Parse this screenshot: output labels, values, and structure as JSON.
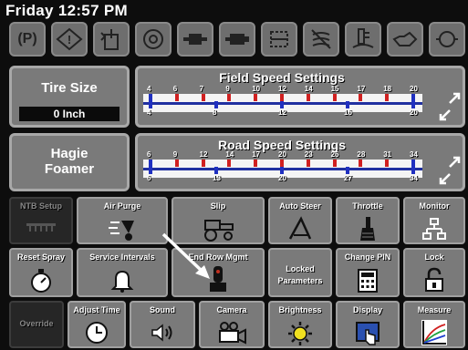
{
  "header": {
    "day_time": "Friday 12:57 PM"
  },
  "warnings": [
    {
      "name": "parking-brake-icon",
      "text": "(P)"
    },
    {
      "name": "engine-warning-icon",
      "text": "!"
    },
    {
      "name": "hydraulic-oil-icon"
    },
    {
      "name": "wheel-icon"
    },
    {
      "name": "transmission-icon"
    },
    {
      "name": "engine-icon"
    },
    {
      "name": "cooling-icon"
    },
    {
      "name": "no-coolant-icon"
    },
    {
      "name": "fuel-temp-icon"
    },
    {
      "name": "oil-icon"
    },
    {
      "name": "oil-pressure-icon"
    }
  ],
  "tire": {
    "title": "Tire Size",
    "value": "0 Inch"
  },
  "field": {
    "title": "Field Speed Settings",
    "top": [
      "4",
      "6",
      "7",
      "9",
      "10",
      "12",
      "14",
      "15",
      "17",
      "18",
      "20"
    ],
    "bottom": [
      "4",
      "8",
      "12",
      "16",
      "20"
    ]
  },
  "hagie": {
    "line1": "Hagie",
    "line2": "Foamer"
  },
  "road": {
    "title": "Road Speed Settings",
    "top": [
      "6",
      "9",
      "12",
      "14",
      "17",
      "20",
      "23",
      "26",
      "28",
      "31",
      "34"
    ],
    "bottom": [
      "6",
      "13",
      "20",
      "27",
      "34"
    ]
  },
  "buttons": {
    "ntb": "NTB Setup",
    "air": "Air Purge",
    "slip": "Slip",
    "steer": "Auto Steer",
    "throttle": "Throttle",
    "monitor": "Monitor",
    "reset": "Reset Spray",
    "service": "Service Intervals",
    "endrow": "End Row Mgmt",
    "locked1": "Locked",
    "locked2": "Parameters",
    "pin": "Change PIN",
    "lock": "Lock",
    "override": "Override",
    "adjust": "Adjust Time",
    "sound": "Sound",
    "camera": "Camera",
    "bright": "Brightness",
    "display": "Display",
    "measure": "Measure"
  }
}
